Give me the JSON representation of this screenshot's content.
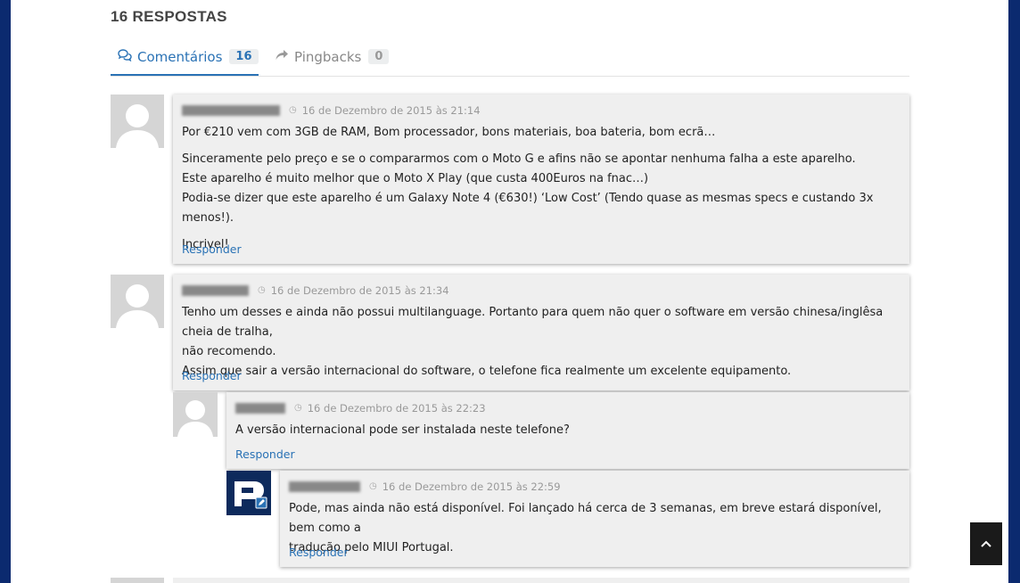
{
  "heading": "16 RESPOSTAS",
  "tabs": {
    "comments": {
      "label": "Comentários",
      "count": "16",
      "icon": "comments-icon"
    },
    "pingbacks": {
      "label": "Pingbacks",
      "count": "0",
      "icon": "share-arrow-icon"
    }
  },
  "comments": [
    {
      "date": "16 de Dezembro de 2015 às 21:14",
      "paragraphs": [
        [
          "Por €210 vem com 3GB de RAM, Bom processador, bons materiais, boa bateria, bom ecrã…"
        ],
        [
          "Sinceramente pelo preço e se o compararmos com o Moto G e afins não se apontar nenhuma falha a este aparelho.",
          "Este aparelho é muito melhor que o Moto X Play (que custa 400Euros na fnac…)",
          "Podia-se dizer que este aparelho é um Galaxy Note 4 (€630!) ‘Low Cost’ (Tendo quase as mesmas specs e custando 3x menos!)."
        ],
        [
          "Incrivel!"
        ]
      ],
      "reply": "Responder"
    },
    {
      "date": "16 de Dezembro de 2015 às 21:34",
      "lines": [
        "Tenho um desses e ainda não possui multilanguage. Portanto para quem não quer o software em versão chinesa/inglêsa cheia de tralha,",
        "não recomendo.",
        "Assim que sair a versão internacional do software, o telefone fica realmente um excelente equipamento."
      ],
      "reply": "Responder"
    },
    {
      "date": "16 de Dezembro de 2015 às 22:23",
      "lines": [
        "A versão internacional pode ser instalada neste telefone?"
      ],
      "reply": "Responder"
    },
    {
      "date": "16 de Dezembro de 2015 às 22:59",
      "lines": [
        "Pode, mas ainda não está disponível. Foi lançado há cerca de 3 semanas, em breve estará disponível, bem como a",
        "tradução pelo MIUI Portugal."
      ],
      "reply": "Responder"
    }
  ],
  "back_to_top_icon": "chevron-up-icon",
  "colors": {
    "accent": "#2a72b5",
    "frame": "#0b2a6f"
  }
}
